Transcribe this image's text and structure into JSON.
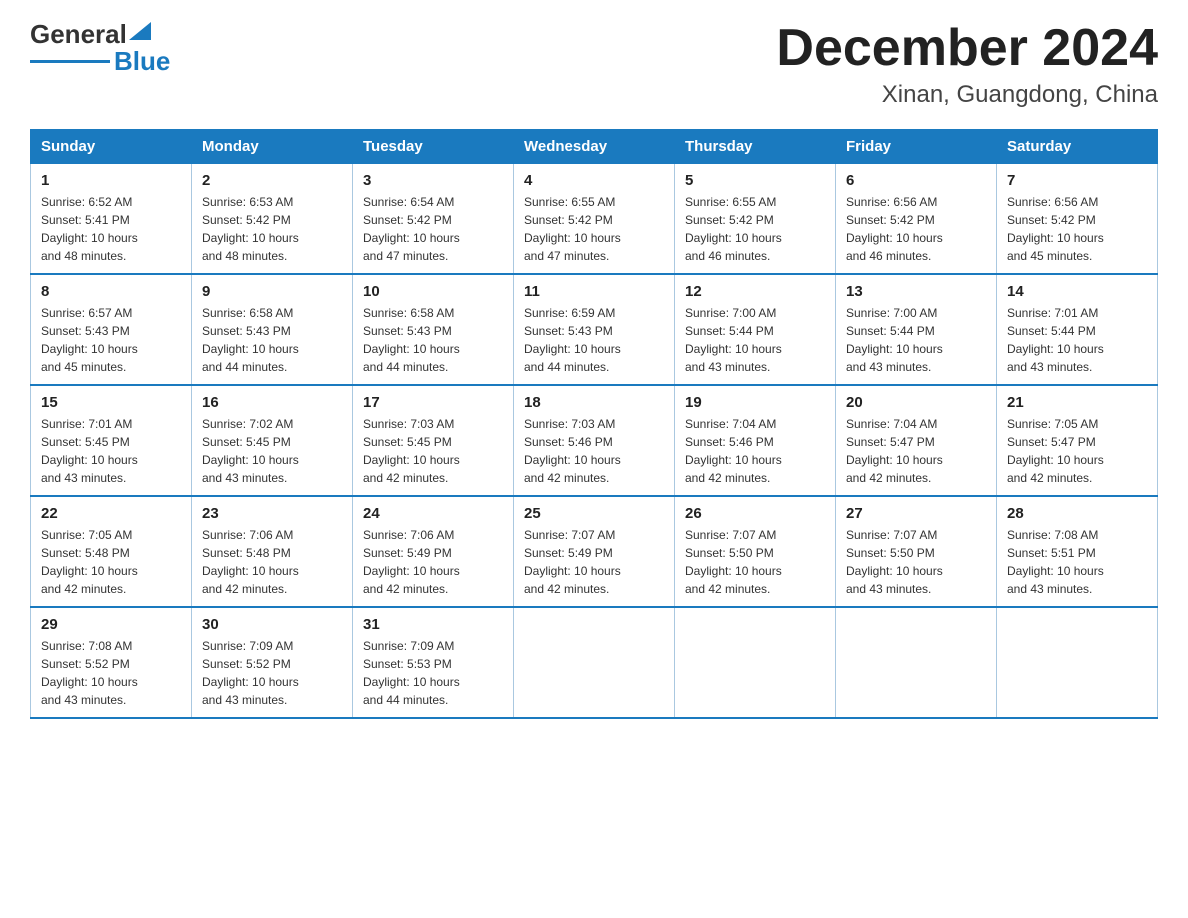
{
  "logo": {
    "text_general": "General",
    "text_blue": "Blue",
    "triangle": "▶"
  },
  "header": {
    "month_year": "December 2024",
    "location": "Xinan, Guangdong, China"
  },
  "weekdays": [
    "Sunday",
    "Monday",
    "Tuesday",
    "Wednesday",
    "Thursday",
    "Friday",
    "Saturday"
  ],
  "weeks": [
    [
      {
        "day": "1",
        "sunrise": "6:52 AM",
        "sunset": "5:41 PM",
        "daylight": "10 hours and 48 minutes."
      },
      {
        "day": "2",
        "sunrise": "6:53 AM",
        "sunset": "5:42 PM",
        "daylight": "10 hours and 48 minutes."
      },
      {
        "day": "3",
        "sunrise": "6:54 AM",
        "sunset": "5:42 PM",
        "daylight": "10 hours and 47 minutes."
      },
      {
        "day": "4",
        "sunrise": "6:55 AM",
        "sunset": "5:42 PM",
        "daylight": "10 hours and 47 minutes."
      },
      {
        "day": "5",
        "sunrise": "6:55 AM",
        "sunset": "5:42 PM",
        "daylight": "10 hours and 46 minutes."
      },
      {
        "day": "6",
        "sunrise": "6:56 AM",
        "sunset": "5:42 PM",
        "daylight": "10 hours and 46 minutes."
      },
      {
        "day": "7",
        "sunrise": "6:56 AM",
        "sunset": "5:42 PM",
        "daylight": "10 hours and 45 minutes."
      }
    ],
    [
      {
        "day": "8",
        "sunrise": "6:57 AM",
        "sunset": "5:43 PM",
        "daylight": "10 hours and 45 minutes."
      },
      {
        "day": "9",
        "sunrise": "6:58 AM",
        "sunset": "5:43 PM",
        "daylight": "10 hours and 44 minutes."
      },
      {
        "day": "10",
        "sunrise": "6:58 AM",
        "sunset": "5:43 PM",
        "daylight": "10 hours and 44 minutes."
      },
      {
        "day": "11",
        "sunrise": "6:59 AM",
        "sunset": "5:43 PM",
        "daylight": "10 hours and 44 minutes."
      },
      {
        "day": "12",
        "sunrise": "7:00 AM",
        "sunset": "5:44 PM",
        "daylight": "10 hours and 43 minutes."
      },
      {
        "day": "13",
        "sunrise": "7:00 AM",
        "sunset": "5:44 PM",
        "daylight": "10 hours and 43 minutes."
      },
      {
        "day": "14",
        "sunrise": "7:01 AM",
        "sunset": "5:44 PM",
        "daylight": "10 hours and 43 minutes."
      }
    ],
    [
      {
        "day": "15",
        "sunrise": "7:01 AM",
        "sunset": "5:45 PM",
        "daylight": "10 hours and 43 minutes."
      },
      {
        "day": "16",
        "sunrise": "7:02 AM",
        "sunset": "5:45 PM",
        "daylight": "10 hours and 43 minutes."
      },
      {
        "day": "17",
        "sunrise": "7:03 AM",
        "sunset": "5:45 PM",
        "daylight": "10 hours and 42 minutes."
      },
      {
        "day": "18",
        "sunrise": "7:03 AM",
        "sunset": "5:46 PM",
        "daylight": "10 hours and 42 minutes."
      },
      {
        "day": "19",
        "sunrise": "7:04 AM",
        "sunset": "5:46 PM",
        "daylight": "10 hours and 42 minutes."
      },
      {
        "day": "20",
        "sunrise": "7:04 AM",
        "sunset": "5:47 PM",
        "daylight": "10 hours and 42 minutes."
      },
      {
        "day": "21",
        "sunrise": "7:05 AM",
        "sunset": "5:47 PM",
        "daylight": "10 hours and 42 minutes."
      }
    ],
    [
      {
        "day": "22",
        "sunrise": "7:05 AM",
        "sunset": "5:48 PM",
        "daylight": "10 hours and 42 minutes."
      },
      {
        "day": "23",
        "sunrise": "7:06 AM",
        "sunset": "5:48 PM",
        "daylight": "10 hours and 42 minutes."
      },
      {
        "day": "24",
        "sunrise": "7:06 AM",
        "sunset": "5:49 PM",
        "daylight": "10 hours and 42 minutes."
      },
      {
        "day": "25",
        "sunrise": "7:07 AM",
        "sunset": "5:49 PM",
        "daylight": "10 hours and 42 minutes."
      },
      {
        "day": "26",
        "sunrise": "7:07 AM",
        "sunset": "5:50 PM",
        "daylight": "10 hours and 42 minutes."
      },
      {
        "day": "27",
        "sunrise": "7:07 AM",
        "sunset": "5:50 PM",
        "daylight": "10 hours and 43 minutes."
      },
      {
        "day": "28",
        "sunrise": "7:08 AM",
        "sunset": "5:51 PM",
        "daylight": "10 hours and 43 minutes."
      }
    ],
    [
      {
        "day": "29",
        "sunrise": "7:08 AM",
        "sunset": "5:52 PM",
        "daylight": "10 hours and 43 minutes."
      },
      {
        "day": "30",
        "sunrise": "7:09 AM",
        "sunset": "5:52 PM",
        "daylight": "10 hours and 43 minutes."
      },
      {
        "day": "31",
        "sunrise": "7:09 AM",
        "sunset": "5:53 PM",
        "daylight": "10 hours and 44 minutes."
      },
      null,
      null,
      null,
      null
    ]
  ]
}
